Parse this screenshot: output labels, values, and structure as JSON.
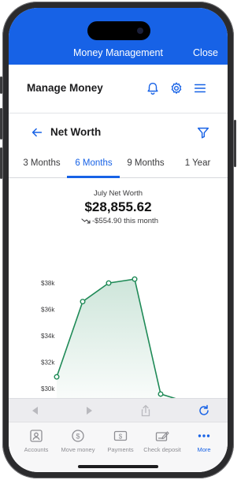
{
  "topbar": {
    "title": "Money Management",
    "close": "Close"
  },
  "header": {
    "title": "Manage Money"
  },
  "subheader": {
    "title": "Net Worth"
  },
  "tabs": [
    {
      "label": "3 Months",
      "active": false
    },
    {
      "label": "6 Months",
      "active": true
    },
    {
      "label": "9 Months",
      "active": false
    },
    {
      "label": "1 Year",
      "active": false
    }
  ],
  "summary": {
    "label": "July Net Worth",
    "value": "$28,855.62",
    "change": "-$554.90",
    "change_suffix": "this month"
  },
  "chart_data": {
    "type": "line",
    "y_tick_labels": [
      "$38k",
      "$36k",
      "$34k",
      "$32k",
      "$30k"
    ],
    "ylim": [
      29000,
      39500
    ],
    "x": [
      0,
      1,
      2,
      3,
      4,
      5
    ],
    "values": [
      30900,
      36600,
      38000,
      38300,
      29600,
      29000
    ],
    "line_color": "#1f8a57",
    "area": true
  },
  "bottom_tabs": [
    {
      "label": "Accounts",
      "icon": "accounts-icon",
      "active": false
    },
    {
      "label": "Move money",
      "icon": "move-money-icon",
      "active": false
    },
    {
      "label": "Payments",
      "icon": "payments-icon",
      "active": false
    },
    {
      "label": "Check deposit",
      "icon": "check-deposit-icon",
      "active": false
    },
    {
      "label": "More",
      "icon": "more-icon",
      "active": true
    }
  ],
  "colors": {
    "brand": "#1762e6",
    "chart": "#1f8a57"
  }
}
